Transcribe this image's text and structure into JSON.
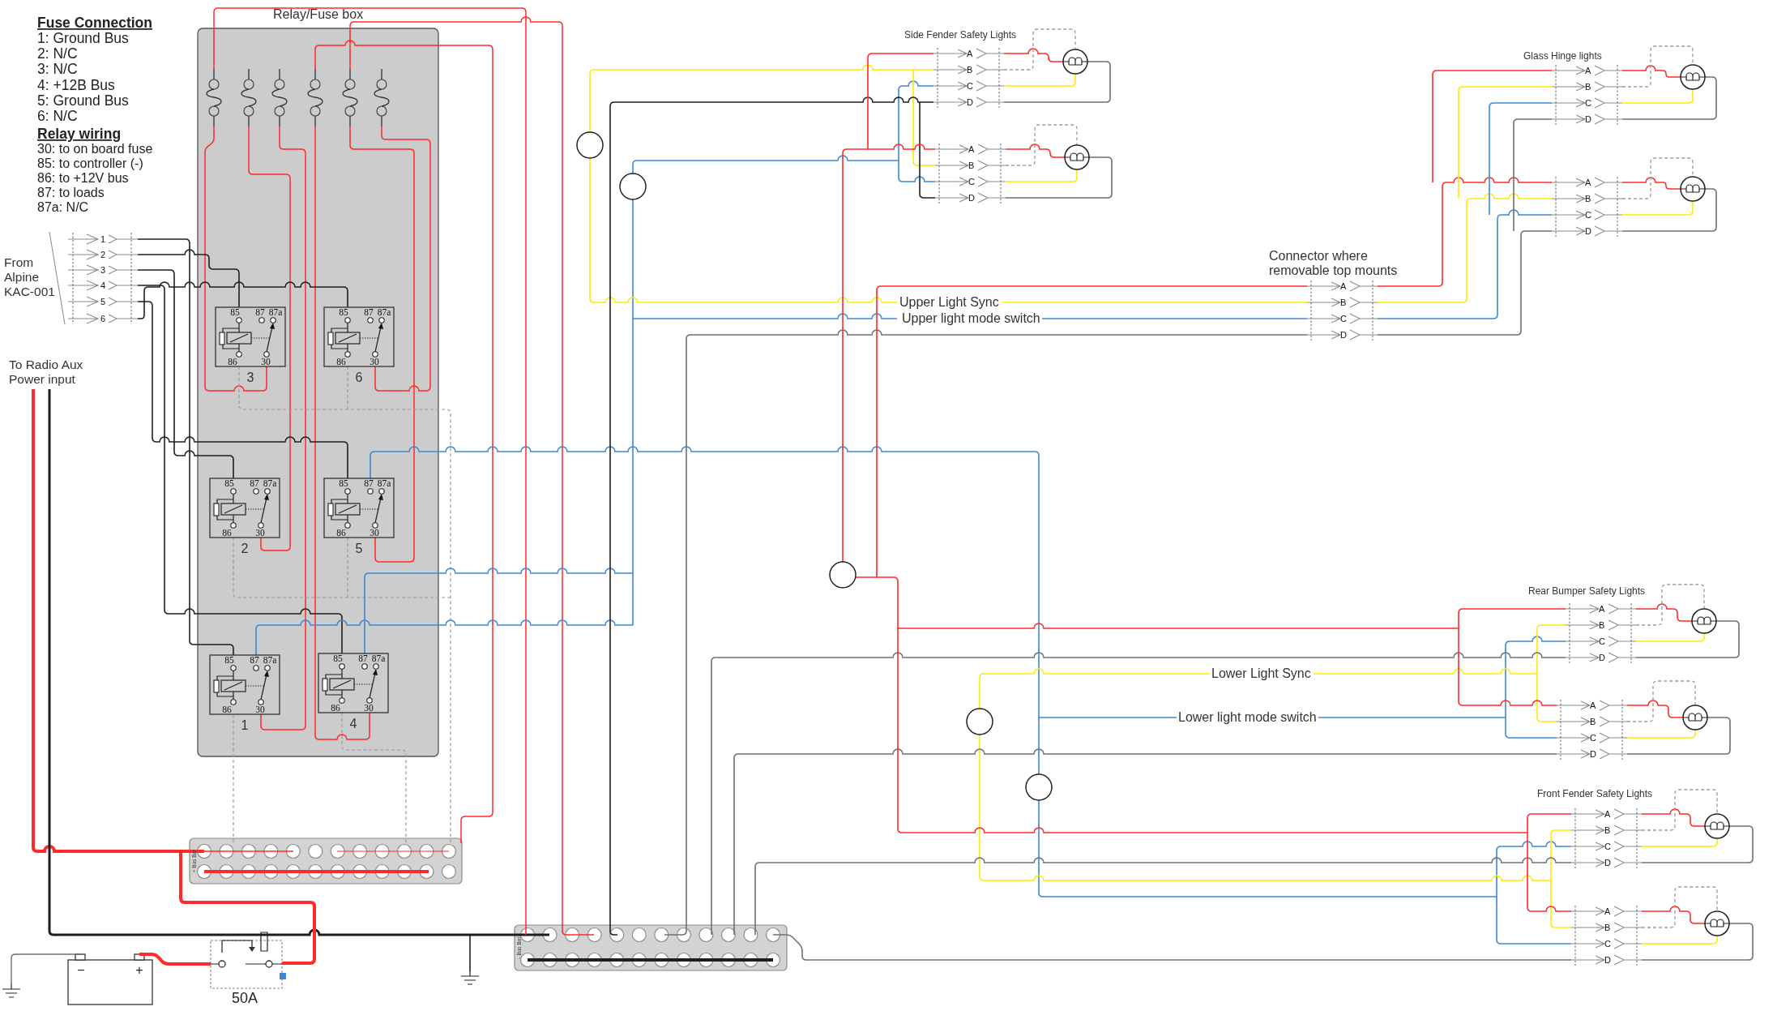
{
  "legend": {
    "fuse_heading": "Fuse Connection",
    "fuse_items": [
      "1: Ground Bus",
      "2: N/C",
      "3: N/C",
      "4: +12B Bus",
      "5: Ground Bus",
      "6: N/C"
    ],
    "relay_heading": "Relay wiring",
    "relay_items": [
      "30: to on board fuse",
      "85: to controller (-)",
      "86: to +12V bus",
      "87: to loads",
      "87a: N/C"
    ]
  },
  "relay_box": {
    "title": "Relay/Fuse box",
    "relays": [
      {
        "number": "3",
        "pins": [
          "85",
          "87",
          "87a",
          "86",
          "30"
        ]
      },
      {
        "number": "6",
        "pins": [
          "85",
          "87",
          "87a",
          "86",
          "30"
        ]
      },
      {
        "number": "2",
        "pins": [
          "85",
          "87",
          "87a",
          "86",
          "30"
        ]
      },
      {
        "number": "5",
        "pins": [
          "85",
          "87",
          "87a",
          "86",
          "30"
        ]
      },
      {
        "number": "1",
        "pins": [
          "85",
          "87",
          "87a",
          "86",
          "30"
        ]
      },
      {
        "number": "4",
        "pins": [
          "85",
          "87",
          "87a",
          "86",
          "30"
        ]
      }
    ]
  },
  "input_connector": {
    "label": [
      "From",
      "Alpine",
      "KAC-001"
    ],
    "pins": [
      "1",
      "2",
      "3",
      "4",
      "5",
      "6"
    ]
  },
  "power_input": {
    "label": [
      "To Radio Aux",
      "Power input"
    ]
  },
  "bus_bars": [
    {
      "label": "+ Bus Bar"
    },
    {
      "label": "- Bus Bar"
    }
  ],
  "battery": {
    "terminals": [
      "−",
      "+"
    ]
  },
  "main_fuse": {
    "rating": "50A"
  },
  "wire_labels": [
    "Upper Light Sync",
    "Upper light mode switch",
    "Lower Light Sync",
    "Lower light mode switch"
  ],
  "top_connector": {
    "label": [
      "Connector where",
      "removable top mounts"
    ],
    "pins": [
      "A",
      "B",
      "C",
      "D"
    ]
  },
  "light_groups": [
    {
      "title": "Side Fender Safety Lights",
      "connectors": [
        {
          "pins": [
            "A",
            "B",
            "C",
            "D"
          ]
        },
        {
          "pins": [
            "A",
            "B",
            "C",
            "D"
          ]
        }
      ]
    },
    {
      "title": "Glass Hinge lights",
      "connectors": [
        {
          "pins": [
            "A",
            "B",
            "C",
            "D"
          ]
        },
        {
          "pins": [
            "A",
            "B",
            "C",
            "D"
          ]
        }
      ]
    },
    {
      "title": "Rear Bumper Safety Lights",
      "connectors": [
        {
          "pins": [
            "A",
            "B",
            "C",
            "D"
          ]
        },
        {
          "pins": [
            "A",
            "B",
            "C",
            "D"
          ]
        }
      ]
    },
    {
      "title": "Front Fender Safety Lights",
      "connectors": [
        {
          "pins": [
            "A",
            "B",
            "C",
            "D"
          ]
        },
        {
          "pins": [
            "A",
            "B",
            "C",
            "D"
          ]
        }
      ]
    }
  ]
}
